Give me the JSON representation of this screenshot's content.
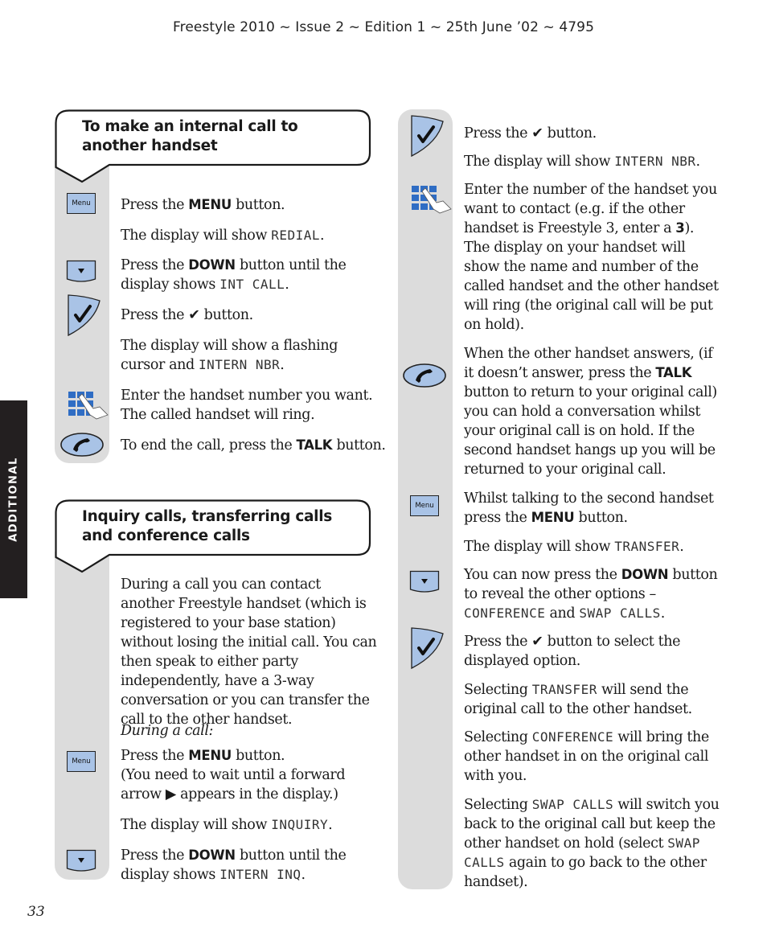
{
  "header": {
    "text": "Freestyle 2010 ~ Issue 2 ~ Edition 1 ~ 25th June ’02 ~ 4795"
  },
  "side_tab": {
    "label": "ADDITIONAL"
  },
  "page_number": "33",
  "icons": {
    "menu_key_label": "Menu",
    "down_key_glyph": "▼",
    "ok_key_glyph": "✔"
  },
  "section1": {
    "title": "To make an internal call to another handset",
    "steps": [
      {
        "icon": "menu-key",
        "parts": [
          "Press the ",
          "MENU",
          " button."
        ]
      },
      {
        "icon": "none",
        "parts": [
          "The display will show ",
          "REDIAL",
          "."
        ]
      },
      {
        "icon": "down-key",
        "parts": [
          "Press the ",
          "DOWN",
          " button until the display shows ",
          "INT CALL",
          "."
        ]
      },
      {
        "icon": "ok-key",
        "parts": [
          "Press the ",
          "✔",
          " button."
        ]
      },
      {
        "icon": "none",
        "parts": [
          "The display will show a flashing cursor and ",
          "INTERN NBR",
          "."
        ]
      },
      {
        "icon": "keypad",
        "parts": [
          "Enter the handset number you want. The called handset will ring."
        ]
      },
      {
        "icon": "talk-key",
        "parts": [
          "To end the call, press the ",
          "TALK",
          " button."
        ]
      }
    ]
  },
  "section2": {
    "title": "Inquiry calls, transferring calls and conference calls",
    "intro": "During a call you can contact another Freestyle handset (which is registered to your base station) without losing the initial call. You can then speak to either party independently, have a 3-way conversation or you can transfer the call to the other handset.",
    "during_label": "During a call:",
    "steps": [
      {
        "icon": "menu-key",
        "parts": [
          "Press the ",
          "MENU",
          " button.",
          "(You need to wait until a forward arrow ▶ appears in the display.)"
        ]
      },
      {
        "icon": "none",
        "parts": [
          "The display will show ",
          "INQUIRY",
          "."
        ]
      },
      {
        "icon": "down-key",
        "parts": [
          "Press the ",
          "DOWN",
          " button until the display shows ",
          "INTERN INQ",
          "."
        ]
      }
    ]
  },
  "section3": {
    "steps": [
      {
        "icon": "ok-key",
        "parts": [
          "Press the ",
          "✔",
          " button."
        ]
      },
      {
        "icon": "none",
        "parts": [
          "The display will show ",
          "INTERN NBR",
          "."
        ]
      },
      {
        "icon": "keypad",
        "parts": [
          "Enter the number of the handset you want to contact (e.g. if the other handset is Freestyle 3, enter a ",
          "3",
          "). The display on your handset will show the name and number of the called handset and the other handset will ring (the original call will be put on hold)."
        ]
      },
      {
        "icon": "talk-key",
        "parts": [
          "When the other handset answers, (if it doesn’t answer, press the ",
          "TALK",
          " button to return to your original call) you can hold a conversation whilst your original call is on hold. If the second handset hangs up you will be returned to your original call."
        ]
      },
      {
        "icon": "menu-key",
        "parts": [
          "Whilst talking to the second handset press the ",
          "MENU",
          " button."
        ]
      },
      {
        "icon": "none",
        "parts": [
          "The display will show ",
          "TRANSFER",
          "."
        ]
      },
      {
        "icon": "down-key",
        "parts": [
          "You can now press the ",
          "DOWN",
          " button to reveal the other options – ",
          "CONFERENCE",
          " and ",
          "SWAP CALLS",
          "."
        ]
      },
      {
        "icon": "ok-key",
        "parts": [
          "Press the ",
          "✔",
          " button to select the displayed option."
        ]
      },
      {
        "icon": "none",
        "parts": [
          "Selecting ",
          "TRANSFER",
          " will send the original call to the other handset."
        ]
      },
      {
        "icon": "none",
        "parts": [
          "Selecting ",
          "CONFERENCE",
          " will bring the other handset in on the original call with you."
        ]
      },
      {
        "icon": "none",
        "parts": [
          "Selecting ",
          "SWAP CALLS",
          " will switch you back to the original call but keep the other handset on hold (select ",
          "SWAP CALLS",
          " again to go back to the other handset)."
        ]
      }
    ]
  }
}
